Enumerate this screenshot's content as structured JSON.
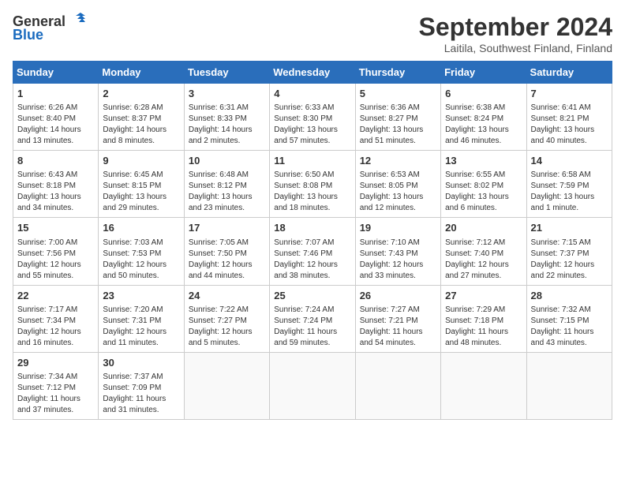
{
  "header": {
    "logo_line1": "General",
    "logo_line2": "Blue",
    "month_title": "September 2024",
    "subtitle": "Laitila, Southwest Finland, Finland"
  },
  "days_of_week": [
    "Sunday",
    "Monday",
    "Tuesday",
    "Wednesday",
    "Thursday",
    "Friday",
    "Saturday"
  ],
  "weeks": [
    [
      {
        "day": "1",
        "sunrise": "Sunrise: 6:26 AM",
        "sunset": "Sunset: 8:40 PM",
        "daylight": "Daylight: 14 hours and 13 minutes."
      },
      {
        "day": "2",
        "sunrise": "Sunrise: 6:28 AM",
        "sunset": "Sunset: 8:37 PM",
        "daylight": "Daylight: 14 hours and 8 minutes."
      },
      {
        "day": "3",
        "sunrise": "Sunrise: 6:31 AM",
        "sunset": "Sunset: 8:33 PM",
        "daylight": "Daylight: 14 hours and 2 minutes."
      },
      {
        "day": "4",
        "sunrise": "Sunrise: 6:33 AM",
        "sunset": "Sunset: 8:30 PM",
        "daylight": "Daylight: 13 hours and 57 minutes."
      },
      {
        "day": "5",
        "sunrise": "Sunrise: 6:36 AM",
        "sunset": "Sunset: 8:27 PM",
        "daylight": "Daylight: 13 hours and 51 minutes."
      },
      {
        "day": "6",
        "sunrise": "Sunrise: 6:38 AM",
        "sunset": "Sunset: 8:24 PM",
        "daylight": "Daylight: 13 hours and 46 minutes."
      },
      {
        "day": "7",
        "sunrise": "Sunrise: 6:41 AM",
        "sunset": "Sunset: 8:21 PM",
        "daylight": "Daylight: 13 hours and 40 minutes."
      }
    ],
    [
      {
        "day": "8",
        "sunrise": "Sunrise: 6:43 AM",
        "sunset": "Sunset: 8:18 PM",
        "daylight": "Daylight: 13 hours and 34 minutes."
      },
      {
        "day": "9",
        "sunrise": "Sunrise: 6:45 AM",
        "sunset": "Sunset: 8:15 PM",
        "daylight": "Daylight: 13 hours and 29 minutes."
      },
      {
        "day": "10",
        "sunrise": "Sunrise: 6:48 AM",
        "sunset": "Sunset: 8:12 PM",
        "daylight": "Daylight: 13 hours and 23 minutes."
      },
      {
        "day": "11",
        "sunrise": "Sunrise: 6:50 AM",
        "sunset": "Sunset: 8:08 PM",
        "daylight": "Daylight: 13 hours and 18 minutes."
      },
      {
        "day": "12",
        "sunrise": "Sunrise: 6:53 AM",
        "sunset": "Sunset: 8:05 PM",
        "daylight": "Daylight: 13 hours and 12 minutes."
      },
      {
        "day": "13",
        "sunrise": "Sunrise: 6:55 AM",
        "sunset": "Sunset: 8:02 PM",
        "daylight": "Daylight: 13 hours and 6 minutes."
      },
      {
        "day": "14",
        "sunrise": "Sunrise: 6:58 AM",
        "sunset": "Sunset: 7:59 PM",
        "daylight": "Daylight: 13 hours and 1 minute."
      }
    ],
    [
      {
        "day": "15",
        "sunrise": "Sunrise: 7:00 AM",
        "sunset": "Sunset: 7:56 PM",
        "daylight": "Daylight: 12 hours and 55 minutes."
      },
      {
        "day": "16",
        "sunrise": "Sunrise: 7:03 AM",
        "sunset": "Sunset: 7:53 PM",
        "daylight": "Daylight: 12 hours and 50 minutes."
      },
      {
        "day": "17",
        "sunrise": "Sunrise: 7:05 AM",
        "sunset": "Sunset: 7:50 PM",
        "daylight": "Daylight: 12 hours and 44 minutes."
      },
      {
        "day": "18",
        "sunrise": "Sunrise: 7:07 AM",
        "sunset": "Sunset: 7:46 PM",
        "daylight": "Daylight: 12 hours and 38 minutes."
      },
      {
        "day": "19",
        "sunrise": "Sunrise: 7:10 AM",
        "sunset": "Sunset: 7:43 PM",
        "daylight": "Daylight: 12 hours and 33 minutes."
      },
      {
        "day": "20",
        "sunrise": "Sunrise: 7:12 AM",
        "sunset": "Sunset: 7:40 PM",
        "daylight": "Daylight: 12 hours and 27 minutes."
      },
      {
        "day": "21",
        "sunrise": "Sunrise: 7:15 AM",
        "sunset": "Sunset: 7:37 PM",
        "daylight": "Daylight: 12 hours and 22 minutes."
      }
    ],
    [
      {
        "day": "22",
        "sunrise": "Sunrise: 7:17 AM",
        "sunset": "Sunset: 7:34 PM",
        "daylight": "Daylight: 12 hours and 16 minutes."
      },
      {
        "day": "23",
        "sunrise": "Sunrise: 7:20 AM",
        "sunset": "Sunset: 7:31 PM",
        "daylight": "Daylight: 12 hours and 11 minutes."
      },
      {
        "day": "24",
        "sunrise": "Sunrise: 7:22 AM",
        "sunset": "Sunset: 7:27 PM",
        "daylight": "Daylight: 12 hours and 5 minutes."
      },
      {
        "day": "25",
        "sunrise": "Sunrise: 7:24 AM",
        "sunset": "Sunset: 7:24 PM",
        "daylight": "Daylight: 11 hours and 59 minutes."
      },
      {
        "day": "26",
        "sunrise": "Sunrise: 7:27 AM",
        "sunset": "Sunset: 7:21 PM",
        "daylight": "Daylight: 11 hours and 54 minutes."
      },
      {
        "day": "27",
        "sunrise": "Sunrise: 7:29 AM",
        "sunset": "Sunset: 7:18 PM",
        "daylight": "Daylight: 11 hours and 48 minutes."
      },
      {
        "day": "28",
        "sunrise": "Sunrise: 7:32 AM",
        "sunset": "Sunset: 7:15 PM",
        "daylight": "Daylight: 11 hours and 43 minutes."
      }
    ],
    [
      {
        "day": "29",
        "sunrise": "Sunrise: 7:34 AM",
        "sunset": "Sunset: 7:12 PM",
        "daylight": "Daylight: 11 hours and 37 minutes."
      },
      {
        "day": "30",
        "sunrise": "Sunrise: 7:37 AM",
        "sunset": "Sunset: 7:09 PM",
        "daylight": "Daylight: 11 hours and 31 minutes."
      },
      null,
      null,
      null,
      null,
      null
    ]
  ]
}
